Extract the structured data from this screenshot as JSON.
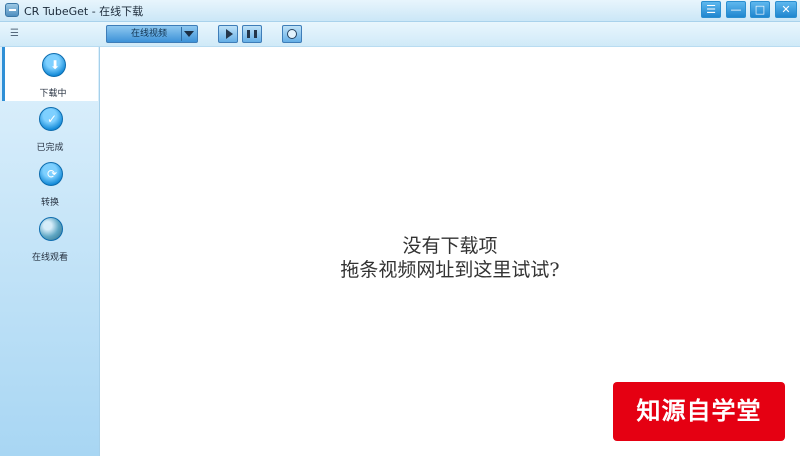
{
  "window": {
    "title": "CR TubeGet - 在线下载",
    "controls": {
      "menu": "☰",
      "minimize": "—",
      "maximize": "□",
      "close": "✕"
    }
  },
  "toolbar": {
    "list_icon": "☰",
    "dropdown_selected": "在线视频",
    "tools": [
      "play-icon",
      "stop-icon",
      "web-icon"
    ]
  },
  "sidebar": {
    "items": [
      {
        "label": "下载中",
        "icon": "download-icon",
        "active": true
      },
      {
        "label": "已完成",
        "icon": "check-icon",
        "active": false
      },
      {
        "label": "转换",
        "icon": "convert-icon",
        "active": false
      },
      {
        "label": "在线观看",
        "icon": "globe-icon",
        "active": false
      }
    ]
  },
  "main": {
    "empty_line1": "没有下载项",
    "empty_line2": "拖条视频网址到这里试试?"
  },
  "watermark": "知源自学堂",
  "colors": {
    "accent": "#2e8fd6",
    "watermark_red": "#e50012"
  }
}
